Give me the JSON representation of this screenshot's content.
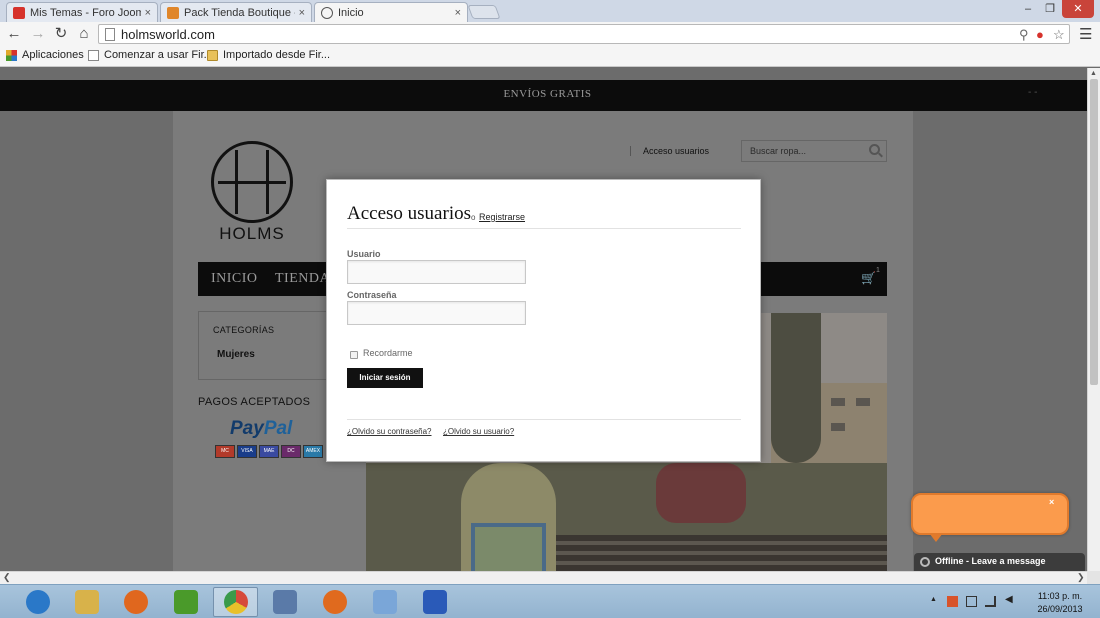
{
  "browser": {
    "tabs": [
      {
        "label": "Mis Temas - Foro Joomla!",
        "icon": "joomla-forum-icon",
        "active": false
      },
      {
        "label": "Pack Tienda Boutique - Ar",
        "icon": "boutique-icon",
        "active": false
      },
      {
        "label": "Inicio",
        "icon": "globe-icon",
        "active": true
      }
    ],
    "tab_close": "×",
    "url": "holmsworld.com",
    "bookmarks": [
      {
        "label": "Aplicaciones",
        "icon": "apps-grid-icon"
      },
      {
        "label": "Comenzar a usar Fir...",
        "icon": "page-icon"
      },
      {
        "label": "Importado desde Fir...",
        "icon": "folder-icon"
      }
    ]
  },
  "site": {
    "banner": "ENVÍOS GRATIS",
    "banner_right": "- -",
    "logo_text": "HOLMS",
    "header_link": "Acceso usuarios",
    "search_placeholder": "Buscar ropa...",
    "nav": [
      "INICIO",
      "TIENDA"
    ],
    "cart_count": "1",
    "categories_title": "CATEGORÍAS",
    "categories": [
      "Mujeres"
    ],
    "payments_title": "PAGOS ACEPTADOS",
    "paypal_pay": "Pay",
    "paypal_pal": "Pal",
    "cards": [
      {
        "label": "MC",
        "color": "#b23a2a"
      },
      {
        "label": "VISA",
        "color": "#1a3d8a"
      },
      {
        "label": "MAE",
        "color": "#3a4aa0"
      },
      {
        "label": "DC",
        "color": "#6a2a6a"
      },
      {
        "label": "AMEX",
        "color": "#2a7aa8"
      }
    ]
  },
  "modal": {
    "title": "Acceso usuarios",
    "or": "o",
    "register_link": "Registrarse",
    "username_label": "Usuario",
    "username_value": "",
    "password_label": "Contraseña",
    "password_value": "",
    "remember_label": "Recordarme",
    "remember_checked": false,
    "submit_label": "Iniciar sesión",
    "forgot_password": "¿Olvido su contraseña?",
    "forgot_username": "¿Olvido su usuario?"
  },
  "chat": {
    "close": "×",
    "status": "Offline - Leave a message"
  },
  "taskbar": {
    "apps": [
      {
        "name": "internet-explorer-icon",
        "color": "#2a78c8",
        "active": false
      },
      {
        "name": "file-explorer-icon",
        "color": "#d8b24a",
        "active": false
      },
      {
        "name": "orange-app-icon",
        "color": "#e0671e",
        "active": false
      },
      {
        "name": "w-app-icon",
        "color": "#4a9a2a",
        "active": false
      },
      {
        "name": "chrome-icon",
        "color": "#d64a3a",
        "active": true
      },
      {
        "name": "network-app-icon",
        "color": "#5a7aa8",
        "active": false
      },
      {
        "name": "firefox-icon",
        "color": "#e06a1e",
        "active": false
      },
      {
        "name": "notepad-app-icon",
        "color": "#7aa6d8",
        "active": false
      },
      {
        "name": "device-app-icon",
        "color": "#2a5ab8",
        "active": false
      }
    ],
    "time": "11:03 p. m.",
    "date": "26/09/2013"
  }
}
